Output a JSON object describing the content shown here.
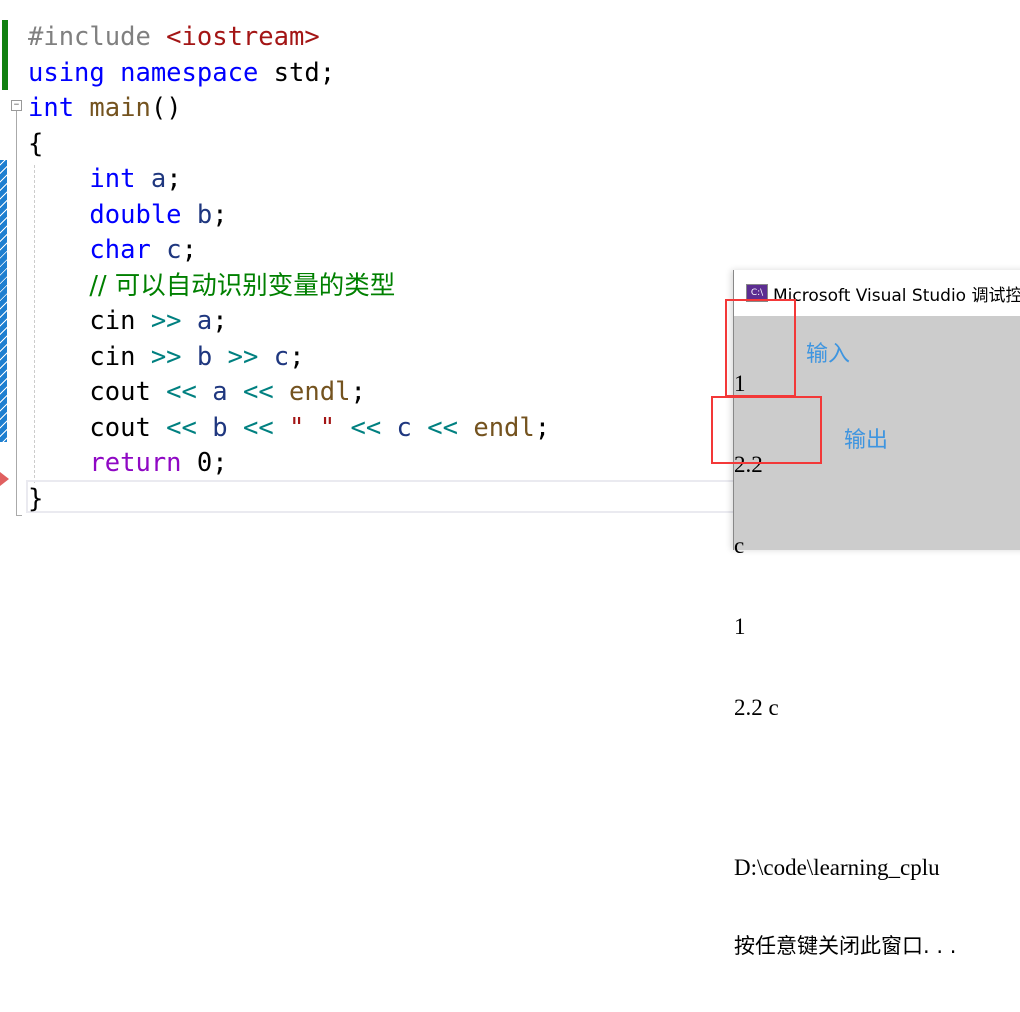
{
  "editor": {
    "lines": [
      [
        [
          "#include ",
          "pp"
        ],
        [
          "<iostream>",
          "str"
        ]
      ],
      [
        [
          "using",
          "kw"
        ],
        [
          " ",
          "pl"
        ],
        [
          "namespace",
          "kw"
        ],
        [
          " std;",
          "pl"
        ]
      ],
      [
        [
          "int",
          "kw"
        ],
        [
          " ",
          "pl"
        ],
        [
          "main",
          "fn"
        ],
        [
          "()",
          "pl"
        ]
      ],
      [
        [
          "{",
          "pl"
        ]
      ],
      [
        [
          "    ",
          "pl"
        ],
        [
          "int",
          "kw"
        ],
        [
          " ",
          "pl"
        ],
        [
          "a",
          "var"
        ],
        [
          ";",
          "pl"
        ]
      ],
      [
        [
          "    ",
          "pl"
        ],
        [
          "double",
          "kw"
        ],
        [
          " ",
          "pl"
        ],
        [
          "b",
          "var"
        ],
        [
          ";",
          "pl"
        ]
      ],
      [
        [
          "    ",
          "pl"
        ],
        [
          "char",
          "kw"
        ],
        [
          " ",
          "pl"
        ],
        [
          "c",
          "var"
        ],
        [
          ";",
          "pl"
        ]
      ],
      [
        [
          "    ",
          "pl"
        ],
        [
          "// 可以自动识别变量的类型",
          "cm"
        ]
      ],
      [
        [
          "    cin ",
          "pl"
        ],
        [
          ">>",
          "op"
        ],
        [
          " ",
          "pl"
        ],
        [
          "a",
          "var"
        ],
        [
          ";",
          "pl"
        ]
      ],
      [
        [
          "    cin ",
          "pl"
        ],
        [
          ">>",
          "op"
        ],
        [
          " ",
          "pl"
        ],
        [
          "b",
          "var"
        ],
        [
          " ",
          "pl"
        ],
        [
          ">>",
          "op"
        ],
        [
          " ",
          "pl"
        ],
        [
          "c",
          "var"
        ],
        [
          ";",
          "pl"
        ]
      ],
      [
        [
          "    cout ",
          "pl"
        ],
        [
          "<<",
          "op"
        ],
        [
          " ",
          "pl"
        ],
        [
          "a",
          "var"
        ],
        [
          " ",
          "pl"
        ],
        [
          "<<",
          "op"
        ],
        [
          " ",
          "pl"
        ],
        [
          "endl",
          "fn"
        ],
        [
          ";",
          "pl"
        ]
      ],
      [
        [
          "    cout ",
          "pl"
        ],
        [
          "<<",
          "op"
        ],
        [
          " ",
          "pl"
        ],
        [
          "b",
          "var"
        ],
        [
          " ",
          "pl"
        ],
        [
          "<<",
          "op"
        ],
        [
          " ",
          "pl"
        ],
        [
          "\" \"",
          "str"
        ],
        [
          " ",
          "pl"
        ],
        [
          "<<",
          "op"
        ],
        [
          " ",
          "pl"
        ],
        [
          "c",
          "var"
        ],
        [
          " ",
          "pl"
        ],
        [
          "<<",
          "op"
        ],
        [
          " ",
          "pl"
        ],
        [
          "endl",
          "fn"
        ],
        [
          ";",
          "pl"
        ]
      ],
      [
        [
          "    ",
          "pl"
        ],
        [
          "return",
          "ret"
        ],
        [
          " 0;",
          "pl"
        ]
      ],
      [
        [
          "}",
          "pl"
        ]
      ]
    ]
  },
  "console": {
    "title": "Microsoft Visual Studio 调试控",
    "icon_text": "C:\\",
    "input_lines": [
      "1",
      "2.2",
      "c"
    ],
    "output_lines": [
      "1",
      "2.2 c"
    ],
    "footer_lines": [
      "D:\\code\\learning_cplu",
      "按任意键关闭此窗口. . ."
    ]
  },
  "annotations": {
    "input_label": "输入",
    "output_label": "输出"
  },
  "colors": {
    "keyword": "#0000ff",
    "string": "#a31515",
    "comment": "#008000",
    "highlight_box": "#f33838",
    "annotation": "#3e95e0"
  }
}
